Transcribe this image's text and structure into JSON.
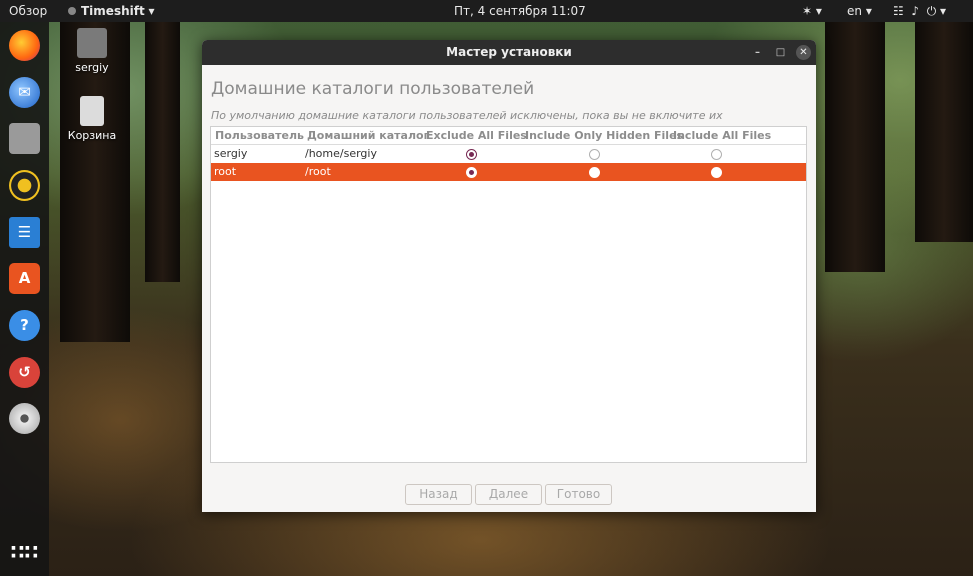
{
  "topbar": {
    "overview": "Обзор",
    "app_name": "Timeshift",
    "datetime": "Пт, 4 сентября  11:07",
    "language": "en"
  },
  "desktop": {
    "icons": [
      {
        "label": "sergiy"
      },
      {
        "label": "Корзина"
      }
    ]
  },
  "dock": {
    "icons": [
      "firefox-icon",
      "thunderbird-icon",
      "files-icon",
      "rhythmbox-icon",
      "writer-icon",
      "software-icon",
      "help-icon",
      "timeshift-icon",
      "disc-icon",
      "app-grid-icon"
    ]
  },
  "window": {
    "title": "Мастер установки",
    "heading": "Домашние каталоги пользователей",
    "subtitle": "По умолчанию домашние каталоги пользователей исключены, пока вы не включите их",
    "columns": [
      "Пользователь",
      "Домашний каталог",
      "Exclude All Files",
      "Include Only Hidden Files",
      "Include All Files"
    ],
    "rows": [
      {
        "user": "sergiy",
        "home": "/home/sergiy",
        "selected_option": "Exclude All Files"
      },
      {
        "user": "root",
        "home": "/root",
        "selected_option": "Exclude All Files"
      }
    ],
    "buttons": {
      "back": "Назад",
      "next": "Далее",
      "done": "Готово"
    }
  },
  "colors": {
    "accent": "#e95420",
    "radio": "#772953",
    "titlebar": "#2d2d2d"
  }
}
